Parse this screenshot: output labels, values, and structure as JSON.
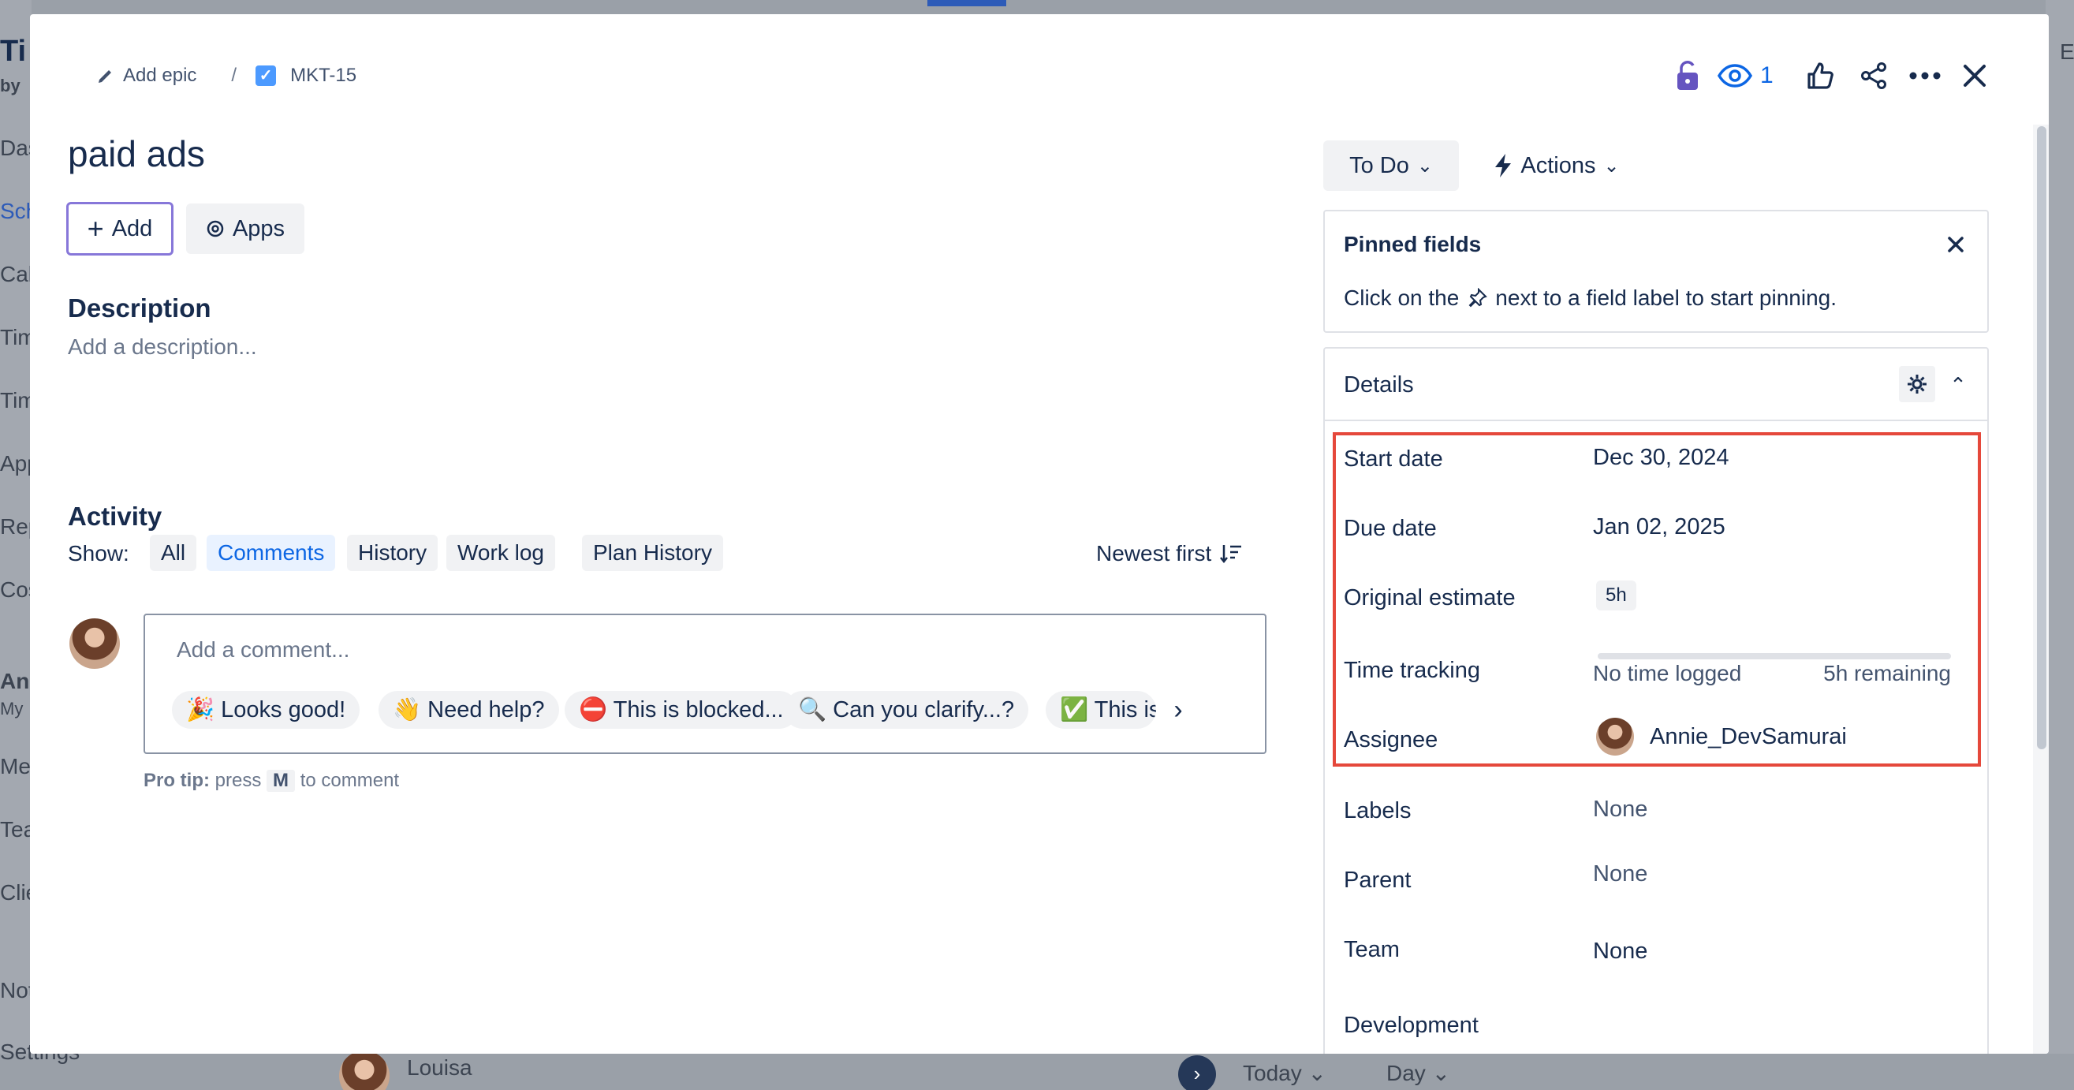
{
  "background": {
    "left_texts": [
      "Ti",
      "by",
      "Das",
      "Sch",
      "Cal",
      "Tim",
      "Tim",
      "App",
      "Rep",
      "Cos",
      "Ann",
      "My",
      "Mer",
      "Tea",
      "Clie",
      "Not",
      "Settings"
    ],
    "bottom": {
      "user": "Louisa",
      "today": "Today",
      "view": "Day"
    },
    "right_text": "E"
  },
  "header": {
    "add_epic": "Add epic",
    "separator": "/",
    "issue_key": "MKT-15",
    "watch_count": "1"
  },
  "issue": {
    "title": "paid ads",
    "add_button": "Add",
    "apps_button": "Apps"
  },
  "description": {
    "heading": "Description",
    "placeholder": "Add a description..."
  },
  "activity": {
    "heading": "Activity",
    "show_label": "Show:",
    "filters": [
      "All",
      "Comments",
      "History",
      "Work log",
      "Plan History"
    ],
    "active_filter": "Comments",
    "sort": "Newest first",
    "comment_placeholder": "Add a comment...",
    "quick_replies": [
      "🎉 Looks good!",
      "👋 Need help?",
      "⛔ This is blocked...",
      "🔍 Can you clarify...?",
      "✅ This is"
    ],
    "pro_tip_bold": "Pro tip:",
    "pro_tip_pre": "press",
    "pro_tip_key": "M",
    "pro_tip_post": "to comment"
  },
  "sidebar": {
    "status": "To Do",
    "actions": "Actions",
    "pinned": {
      "title": "Pinned fields",
      "text_before": "Click on the",
      "text_after": "next to a field label to start pinning."
    },
    "details_title": "Details",
    "fields": {
      "start_date": {
        "label": "Start date",
        "value": "Dec 30, 2024"
      },
      "due_date": {
        "label": "Due date",
        "value": "Jan 02, 2025"
      },
      "original_estimate": {
        "label": "Original estimate",
        "value": "5h"
      },
      "time_tracking": {
        "label": "Time tracking",
        "logged": "No time logged",
        "remaining": "5h remaining",
        "logged_fraction": 0
      },
      "assignee": {
        "label": "Assignee",
        "value": "Annie_DevSamurai"
      },
      "labels": {
        "label": "Labels",
        "value": "None"
      },
      "parent": {
        "label": "Parent",
        "value": "None"
      },
      "team": {
        "label": "Team",
        "value": "None"
      },
      "development": {
        "label": "Development"
      }
    }
  },
  "colors": {
    "highlight": "#e5483b",
    "link": "#0c66e4",
    "add_outline": "#8777d9",
    "lock": "#6554c0"
  }
}
